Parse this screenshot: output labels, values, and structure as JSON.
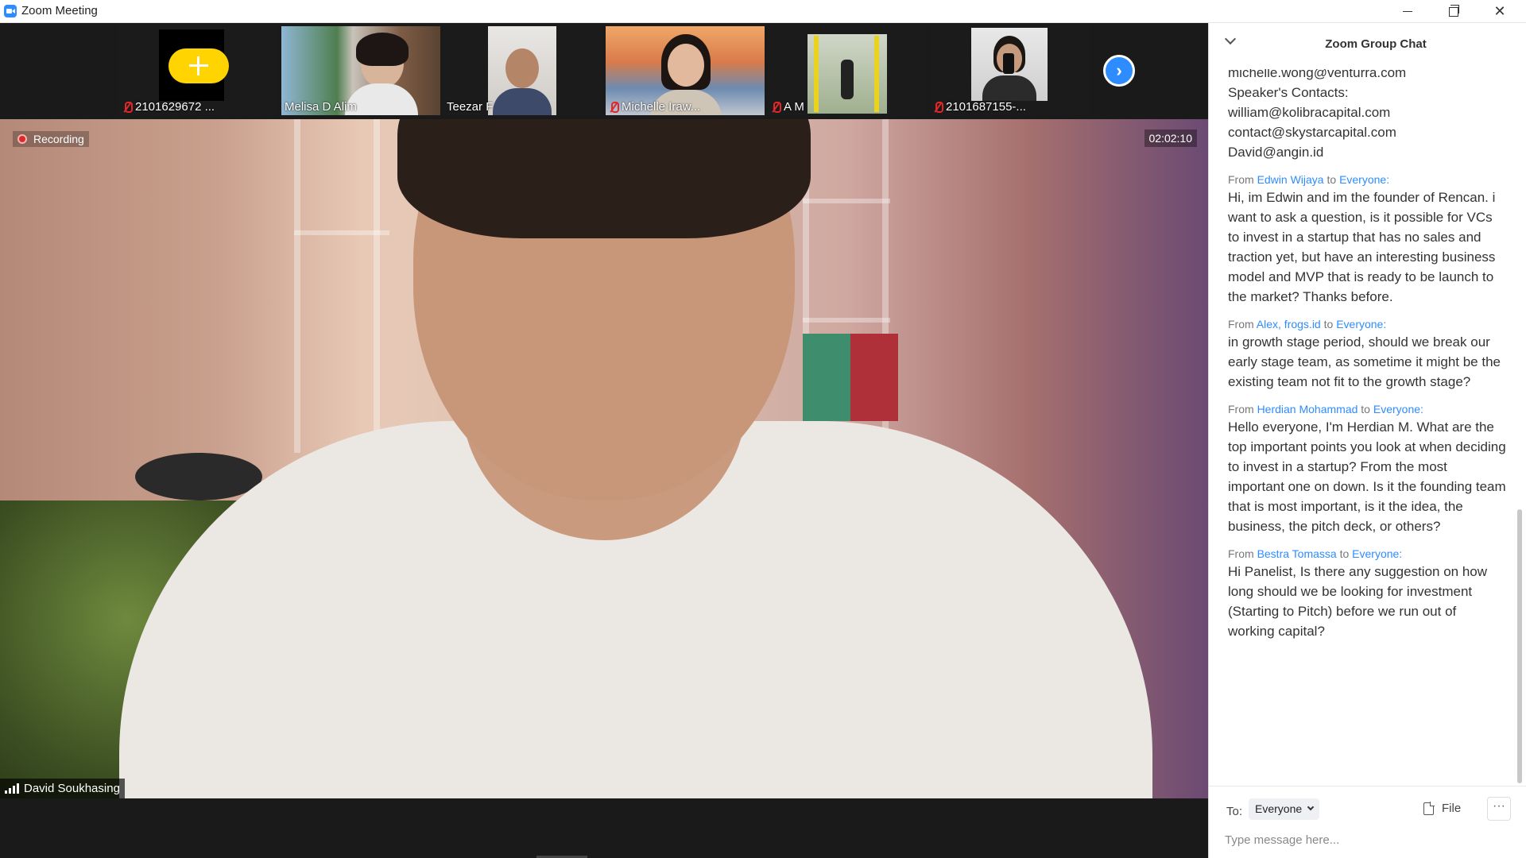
{
  "window": {
    "title": "Zoom Meeting"
  },
  "participants": [
    {
      "name": "2101629672 ...",
      "muted": true,
      "tile": "yellow-avatar"
    },
    {
      "name": "Melisa D Alim",
      "muted": false,
      "tile": "video"
    },
    {
      "name": "Teezar F",
      "muted": false,
      "tile": "video"
    },
    {
      "name": "Michelle Iraw...",
      "muted": true,
      "tile": "video"
    },
    {
      "name": "A M",
      "muted": true,
      "tile": "video"
    },
    {
      "name": "2101687155-...",
      "muted": true,
      "tile": "video"
    }
  ],
  "main_video": {
    "recording_label": "Recording",
    "timer": "02:02:10",
    "speaker_name": "David Soukhasing"
  },
  "chat": {
    "title": "Zoom Group Chat",
    "partial_message": "michelle.wong@venturra.com\nSpeaker's Contacts:\nwilliam@kolibracapital.com\ncontact@skystarcapital.com\nDavid@angin.id",
    "messages": [
      {
        "from": "Edwin Wijaya",
        "to": "Everyone:",
        "text": "Hi, im Edwin and im the founder of Rencan. i want to ask a question, is it possible for VCs to invest in a startup that has no sales and traction yet, but have an interesting business model and MVP that is ready to be launch to the market? Thanks before."
      },
      {
        "from": "Alex, frogs.id",
        "to": "Everyone:",
        "text": "in growth stage period, should we break our early stage team, as sometime it might be the existing team not fit to the growth stage?"
      },
      {
        "from": "Herdian Mohammad",
        "to": "Everyone:",
        "text": "Hello everyone, I'm Herdian M. What are the top important points you look at when deciding to invest in a startup? From the most important one on down. Is it the founding team that is most important, is it the idea, the business, the pitch deck, or others?"
      },
      {
        "from": "Bestra Tomassa",
        "to": "Everyone:",
        "text": "Hi Panelist, Is there any suggestion on how long should we be looking for investment (Starting to Pitch) before we run out of working capital?"
      }
    ],
    "from_word": "From",
    "to_word": "to",
    "footer": {
      "to_label": "To:",
      "recipient": "Everyone",
      "file_label": "File",
      "more_label": "···",
      "placeholder": "Type message here..."
    }
  },
  "colors": {
    "accent": "#2d8cff",
    "muted_red": "#e02828",
    "avatar_yellow": "#ffd400"
  }
}
